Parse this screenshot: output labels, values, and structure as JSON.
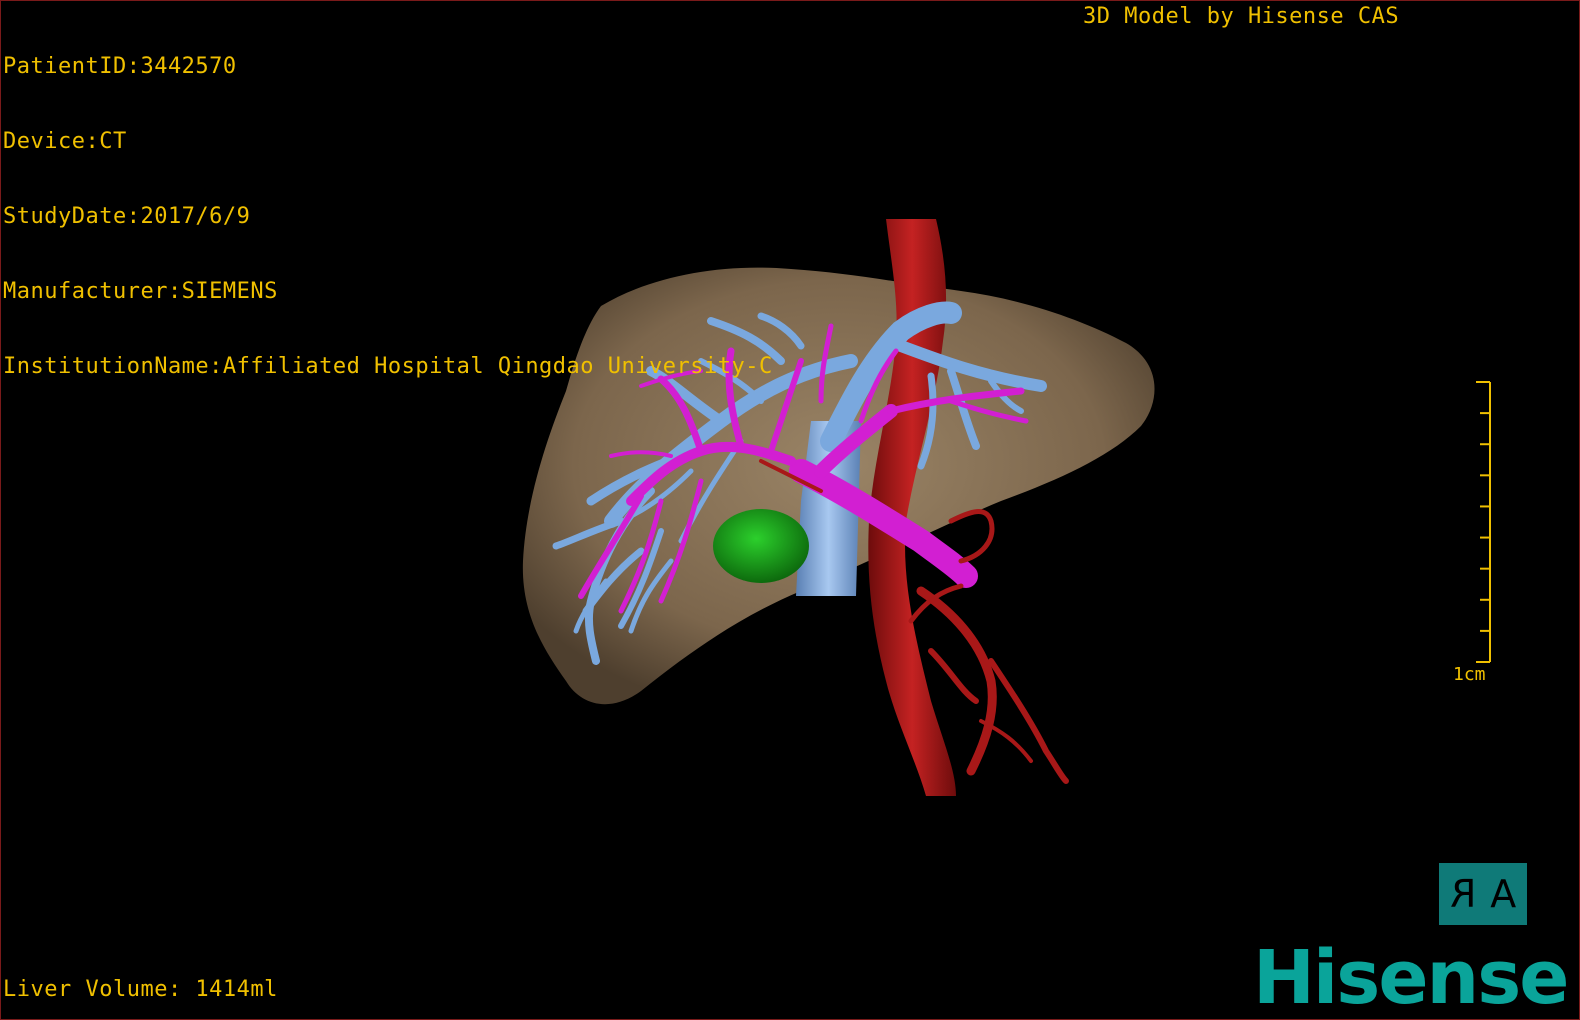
{
  "header": {
    "patient_id": "PatientID:3442570",
    "device": "Device:CT",
    "study_date": "StudyDate:2017/6/9",
    "manufacturer": "Manufacturer:SIEMENS",
    "institution": "InstitutionName:Affiliated Hospital Qingdao University-C"
  },
  "credit": "3D Model by Hisense CAS",
  "footer": {
    "liver_volume": "Liver Volume: 1414ml"
  },
  "scale": {
    "label": "1cm"
  },
  "orientation": {
    "left_glyph": "R",
    "right_glyph": "A"
  },
  "brand": {
    "name": "Hisense",
    "color": "#0aa49a"
  },
  "colors": {
    "overlay_text": "#f0c000",
    "liver": "#8a7358",
    "portal_vein": "#7aa8de",
    "hepatic_artery": "#d21fd2",
    "aorta": "#b01a1a",
    "lesion": "#1aa51a",
    "orientation_box": "#0f7a78"
  }
}
